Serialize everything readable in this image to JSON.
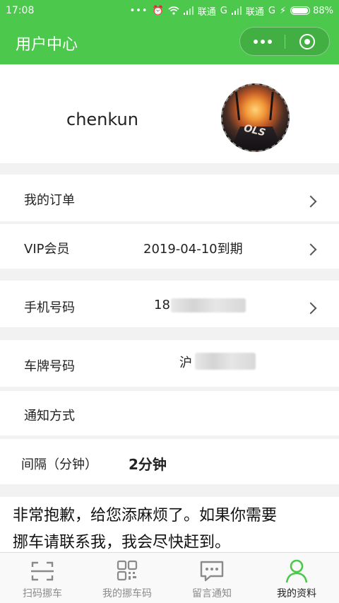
{
  "status_bar": {
    "time": "17:08",
    "carrier1": "联通",
    "network1": "G",
    "carrier2": "联通",
    "network2": "G",
    "battery": "88%",
    "battery_level": 0.88
  },
  "navbar": {
    "title": "用户中心",
    "more_icon": "more-dots-icon",
    "close_icon": "target-circle-icon"
  },
  "profile": {
    "username": "chenkun",
    "avatar_text": "OLS"
  },
  "rows": {
    "orders": {
      "label": "我的订单"
    },
    "vip": {
      "label": "VIP会员",
      "value": "2019-04-10到期"
    },
    "phone": {
      "label": "手机号码",
      "value": "18"
    },
    "plate": {
      "label": "车牌号码",
      "value": "沪"
    },
    "notify": {
      "label": "通知方式"
    },
    "interval": {
      "label": "间隔（分钟）",
      "value": "2分钟"
    }
  },
  "message": {
    "line1": "非常抱歉，给您添麻烦了。如果你需要",
    "line2": "挪车请联系我，我会尽快赶到。"
  },
  "tabbar": {
    "tabs": [
      {
        "label": "扫码挪车",
        "icon": "scan-icon"
      },
      {
        "label": "我的挪车码",
        "icon": "qrcode-icon"
      },
      {
        "label": "留言通知",
        "icon": "chat-bubble-icon"
      },
      {
        "label": "我的资料",
        "icon": "user-icon"
      }
    ],
    "active_index": 3
  },
  "colors": {
    "brand": "#4cc84d",
    "text": "#222222",
    "muted": "#8a8a8a"
  }
}
